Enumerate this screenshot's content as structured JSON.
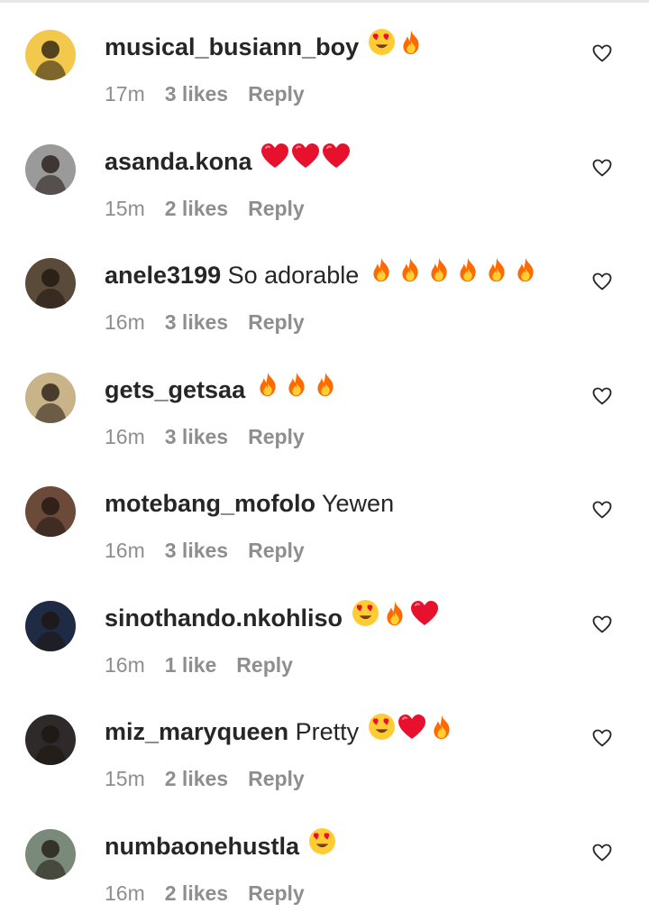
{
  "comments": [
    {
      "username": "musical_busiann_boy",
      "text": "",
      "emojis": [
        "heart-eyes",
        "fire"
      ],
      "time": "17m",
      "likes": "3 likes",
      "reply": "Reply",
      "avatar_color": "#f2c94c"
    },
    {
      "username": "asanda.kona",
      "text": "",
      "emojis": [
        "red-heart",
        "red-heart",
        "red-heart"
      ],
      "time": "15m",
      "likes": "2 likes",
      "reply": "Reply",
      "avatar_color": "#9a9a9a"
    },
    {
      "username": "anele3199",
      "text": "So adorable",
      "emojis": [
        "fire",
        "fire",
        "fire",
        "fire",
        "fire",
        "fire"
      ],
      "time": "16m",
      "likes": "3 likes",
      "reply": "Reply",
      "avatar_color": "#5a4a3a"
    },
    {
      "username": "gets_getsaa",
      "text": "",
      "emojis": [
        "fire",
        "fire",
        "fire"
      ],
      "time": "16m",
      "likes": "3 likes",
      "reply": "Reply",
      "avatar_color": "#c9b48a"
    },
    {
      "username": "motebang_mofolo",
      "text": "Yewen",
      "emojis": [],
      "time": "16m",
      "likes": "3 likes",
      "reply": "Reply",
      "avatar_color": "#6b4a3a"
    },
    {
      "username": "sinothando.nkohliso",
      "text": "",
      "emojis": [
        "heart-eyes",
        "fire",
        "red-heart"
      ],
      "time": "16m",
      "likes": "1 like",
      "reply": "Reply",
      "avatar_color": "#1f2a44"
    },
    {
      "username": "miz_maryqueen",
      "text": "Pretty",
      "emojis": [
        "heart-eyes",
        "red-heart",
        "fire"
      ],
      "time": "15m",
      "likes": "2 likes",
      "reply": "Reply",
      "avatar_color": "#2e2a2a"
    },
    {
      "username": "numbaonehustla",
      "text": "",
      "emojis": [
        "heart-eyes"
      ],
      "time": "16m",
      "likes": "2 likes",
      "reply": "Reply",
      "avatar_color": "#7a8a7a"
    }
  ],
  "icons": {
    "like": "heart-outline-icon"
  },
  "colors": {
    "text": "#262626",
    "meta": "#8e8e8e",
    "heart": "#e8112d",
    "fire": "#ff6a00"
  }
}
